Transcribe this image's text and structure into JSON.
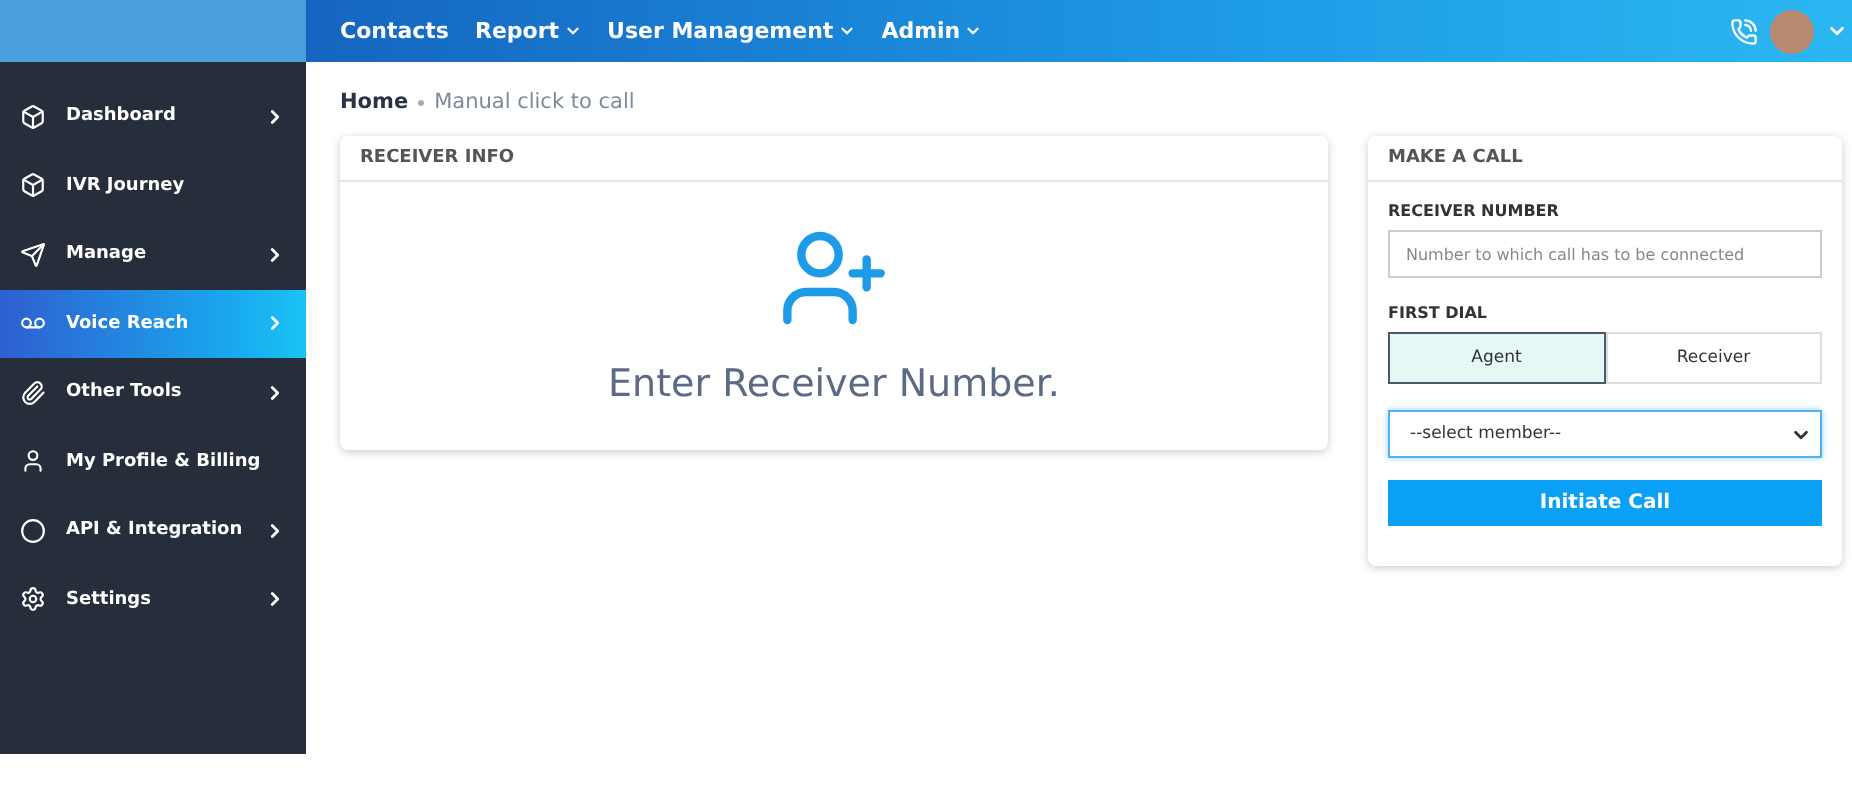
{
  "topbar": {
    "menu": [
      {
        "label": "Contacts",
        "dropdown": false
      },
      {
        "label": "Report",
        "dropdown": true
      },
      {
        "label": "User Management",
        "dropdown": true
      },
      {
        "label": "Admin",
        "dropdown": true
      }
    ]
  },
  "sidebar": {
    "items": [
      {
        "label": "Dashboard",
        "expandable": true,
        "selected": false
      },
      {
        "label": "IVR Journey",
        "expandable": false,
        "selected": false
      },
      {
        "label": "Manage",
        "expandable": true,
        "selected": false
      },
      {
        "label": "Voice Reach",
        "expandable": true,
        "selected": true
      },
      {
        "label": "Other Tools",
        "expandable": true,
        "selected": false
      },
      {
        "label": "My Profile & Billing",
        "expandable": false,
        "selected": false
      },
      {
        "label": "API & Integration",
        "expandable": true,
        "selected": false
      },
      {
        "label": "Settings",
        "expandable": true,
        "selected": false
      }
    ]
  },
  "breadcrumb": [
    "Home",
    "Manual click to call"
  ],
  "receiver_info": {
    "title": "RECEIVER INFO",
    "message": "Enter Receiver Number."
  },
  "make_a_call": {
    "title": "MAKE A CALL",
    "number_label": "RECEIVER NUMBER",
    "number_placeholder": "Number to which call has to be connected",
    "first_dial_label": "FIRST DIAL",
    "first_dial": [
      {
        "label": "Agent",
        "selected": true
      },
      {
        "label": "Receiver",
        "selected": false
      }
    ],
    "member_select": "--select member--",
    "button": "Initiate Call"
  }
}
